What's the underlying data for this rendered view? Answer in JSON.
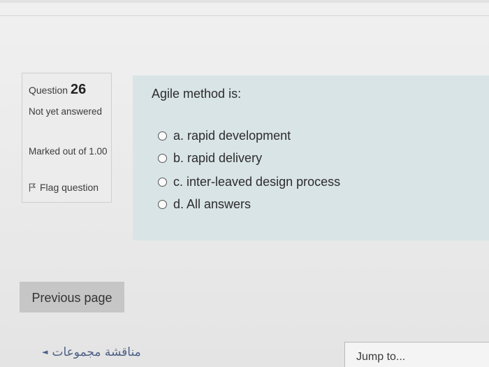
{
  "question_info": {
    "label": "Question",
    "number": "26",
    "state": "Not yet answered",
    "marked": "Marked out of 1.00",
    "flag_label": "Flag question"
  },
  "question": {
    "text": "Agile method is:",
    "answers": [
      "a. rapid development",
      "b. rapid delivery",
      "c. inter-leaved design process",
      "d. All answers"
    ]
  },
  "navigation": {
    "previous_page": "Previous page",
    "prev_activity_link": "مناقشة مجموعات",
    "jump_to": "Jump to..."
  }
}
